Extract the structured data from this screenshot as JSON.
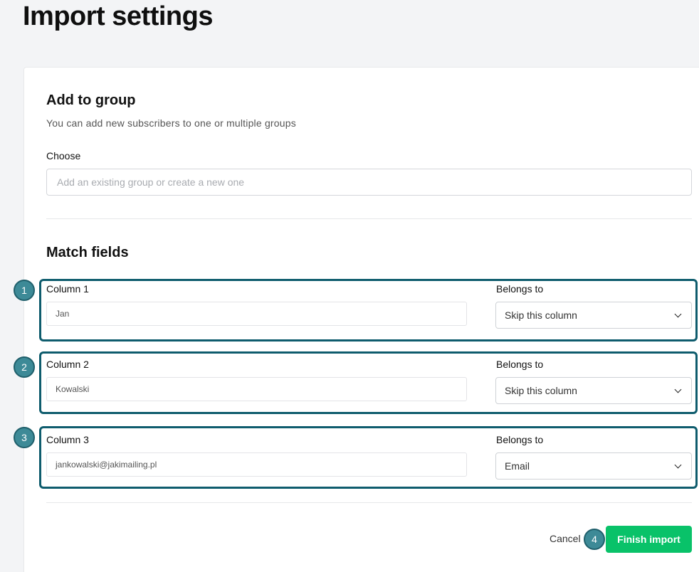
{
  "page": {
    "title": "Import settings"
  },
  "add_to_group": {
    "title": "Add to group",
    "subtitle": "You can add new subscribers to one or multiple groups",
    "choose_label": "Choose",
    "input_placeholder": "Add an existing group or create a new one"
  },
  "match_fields": {
    "title": "Match fields",
    "belongs_to_label": "Belongs to",
    "columns": [
      {
        "step": "1",
        "label": "Column 1",
        "value": "Jan",
        "belongs_to": "Skip this column"
      },
      {
        "step": "2",
        "label": "Column 2",
        "value": "Kowalski",
        "belongs_to": "Skip this column"
      },
      {
        "step": "3",
        "label": "Column 3",
        "value": "jankowalski@jakimailing.pl",
        "belongs_to": "Email"
      }
    ]
  },
  "actions": {
    "cancel_label": "Cancel",
    "finish_label": "Finish import",
    "finish_step": "4"
  },
  "colors": {
    "accent_green": "#09c269",
    "highlight_border": "#0e5c6d",
    "step_badge": "#3d8a97"
  },
  "icons": {
    "dropdown": "chevron-down-icon"
  }
}
